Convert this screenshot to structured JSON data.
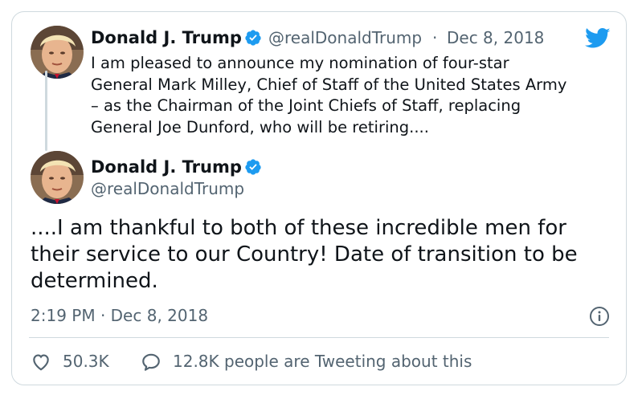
{
  "brand": {
    "accent": "#1d9bf0",
    "text": "#0f1419",
    "secondary": "#536471",
    "border": "#cfd9de"
  },
  "logo_icon": "twitter-bird-icon",
  "quoted_tweet": {
    "author_name": "Donald J. Trump",
    "verified_icon": "verified-badge-icon",
    "handle": "@realDonaldTrump",
    "separator": "·",
    "date": "Dec 8, 2018",
    "text": "I am pleased to announce my nomination of four-star\nGeneral Mark Milley, Chief of Staff of the United States Army\n– as the Chairman of the Joint Chiefs of Staff, replacing\nGeneral Joe Dunford, who will be retiring...."
  },
  "main_tweet": {
    "author_name": "Donald J. Trump",
    "verified_icon": "verified-badge-icon",
    "handle": "@realDonaldTrump",
    "text": "....I am thankful to both of these incredible men for\ntheir service to our Country! Date of transition to be\ndetermined.",
    "timestamp": "2:19 PM · Dec 8, 2018",
    "info_icon": "info-icon"
  },
  "stats": {
    "like_icon": "heart-icon",
    "likes": "50.3K",
    "reply_icon": "speech-bubble-icon",
    "tweeting_text": "12.8K people are Tweeting about this"
  }
}
